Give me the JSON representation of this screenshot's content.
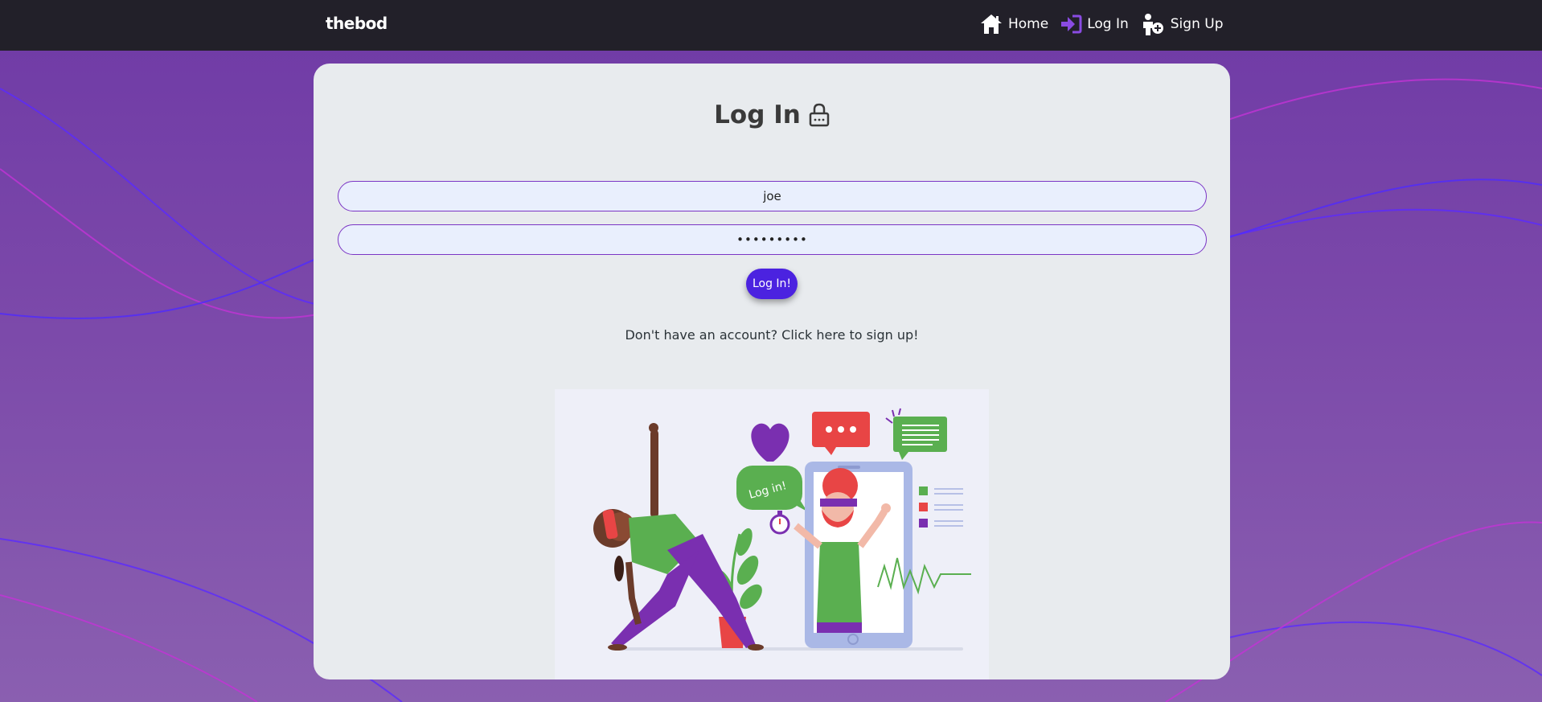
{
  "navbar": {
    "brand": "thebod",
    "links": [
      {
        "label": "Home",
        "icon": "home-icon"
      },
      {
        "label": "Log In",
        "icon": "login-arrow-icon"
      },
      {
        "label": "Sign Up",
        "icon": "add-user-icon"
      }
    ]
  },
  "login": {
    "title": "Log In",
    "title_icon": "lock-icon",
    "username_value": "joe",
    "password_value": "password1",
    "submit_label": "Log In!",
    "signup_prompt": "Don't have an account? Click here to sign up!"
  },
  "illustration": {
    "bubble_text": "Log in!"
  },
  "colors": {
    "navbar_bg": "#222029",
    "accent": "#7b35c5",
    "button": "#4b22e0",
    "card_bg": "#e8ebee"
  }
}
